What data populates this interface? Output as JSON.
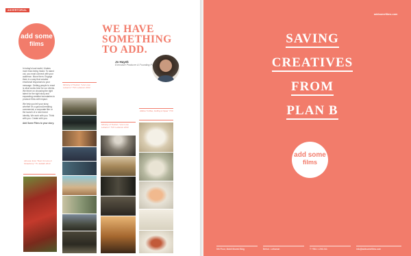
{
  "left": {
    "tag": "ADVERTORIAL",
    "logo": {
      "line1": "add some",
      "line2": "films"
    },
    "headline": [
      "WE HAVE",
      "SOMETHING",
      "TO ADD."
    ],
    "author": {
      "name": "Jo Hayek",
      "role": "Executive Producer & Founding Partner"
    },
    "body": [
      "In today's loud world, it takes more than being heard. To stand out, you must connect with your audience. Move them. Engage them in a way that creates emotional responses to your message. Getting people to react is what works best for our clients. We thrive on choosing the right talent for the right story and expanding creative boundaries to produce films with impact.",
      "We help you tell your story, whether it's a ground-breaking commercial, a corporate film or the launch of a new brand identity. We work with you. Think with you. Create with you."
    ],
    "body_strong": "Add Some Films to your story.",
    "quote1": "Almarai Juice \"Rest Immune & Strawberry\" TV Jeddah 2013",
    "caption2": "Ministry of Tourism \"Live Love Lebanon\" TVC Lebanon 2013",
    "caption3": "Ministry of Tourism \"Live Love Lebanon\" TVC Lebanon 2013",
    "caption4": "Alfaba \"Coffee, Golfing & Spaa\" TVC"
  },
  "right": {
    "url": "addsomefilms.com",
    "title": [
      "SAVING",
      "CREATIVES",
      "FROM",
      "PLAN B"
    ],
    "logo": {
      "line1": "add some",
      "line2": "films"
    },
    "footer": [
      "5th Floor, Mobil Moved Bldg",
      "Beirut - Lebanon",
      "T +961 1 206 241",
      "info@addsomefilms.com"
    ]
  },
  "colors": {
    "accent": "#f27c6b",
    "tag": "#e04a3c"
  }
}
